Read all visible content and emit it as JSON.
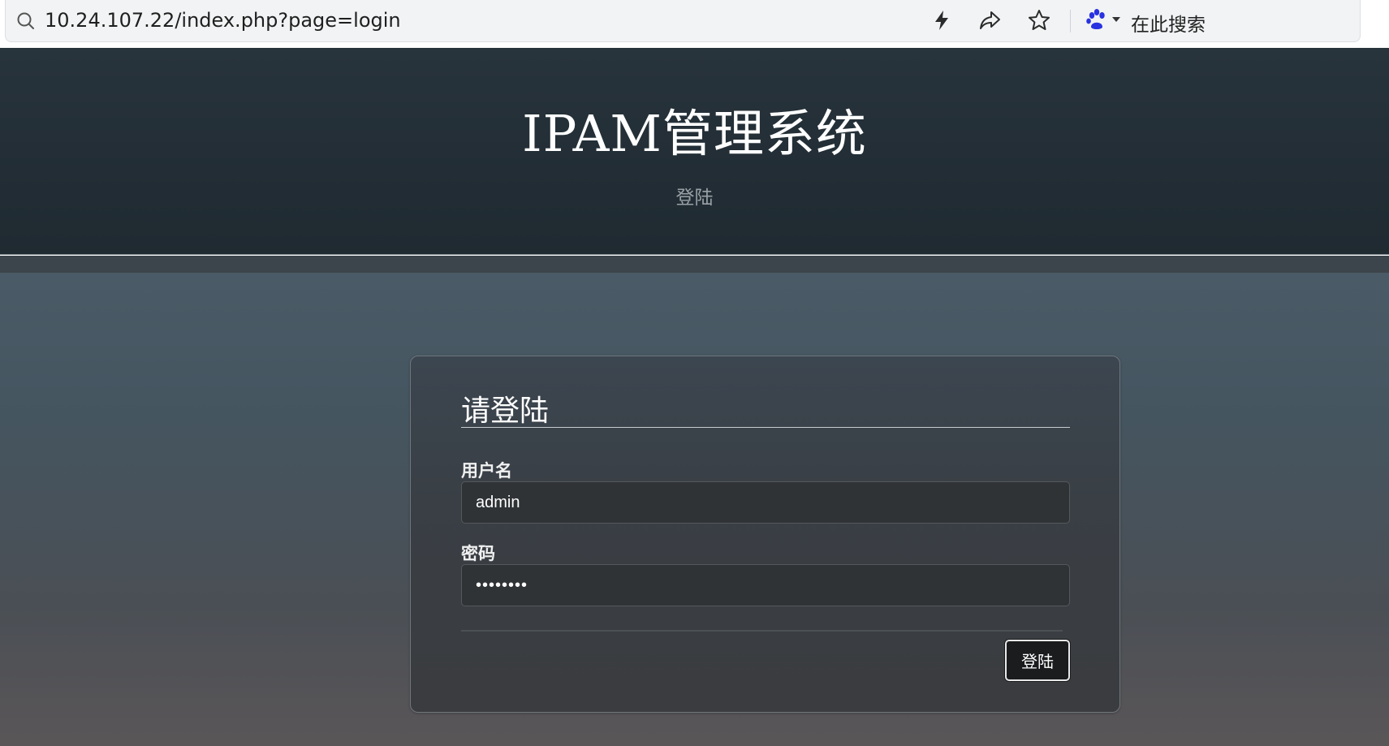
{
  "browser": {
    "address_url": "10.24.107.22/index.php?page=login",
    "search_engine_placeholder": "在此搜索",
    "icons": [
      "search-icon",
      "lightning-icon",
      "share-icon",
      "star-icon",
      "baidu-paw-icon"
    ],
    "engine_color": "#2932e1"
  },
  "header": {
    "title": "IPAM管理系统",
    "subtitle": "登陆"
  },
  "login": {
    "heading": "请登陆",
    "username_label": "用户名",
    "username_value": "admin",
    "password_label": "密码",
    "password_value": "••••••••",
    "submit_label": "登陆"
  },
  "colors": {
    "header_bg": "#222d35",
    "panel_bg": "#393f45",
    "input_bg": "#2f3336",
    "button_bg": "#1a1c1e"
  }
}
